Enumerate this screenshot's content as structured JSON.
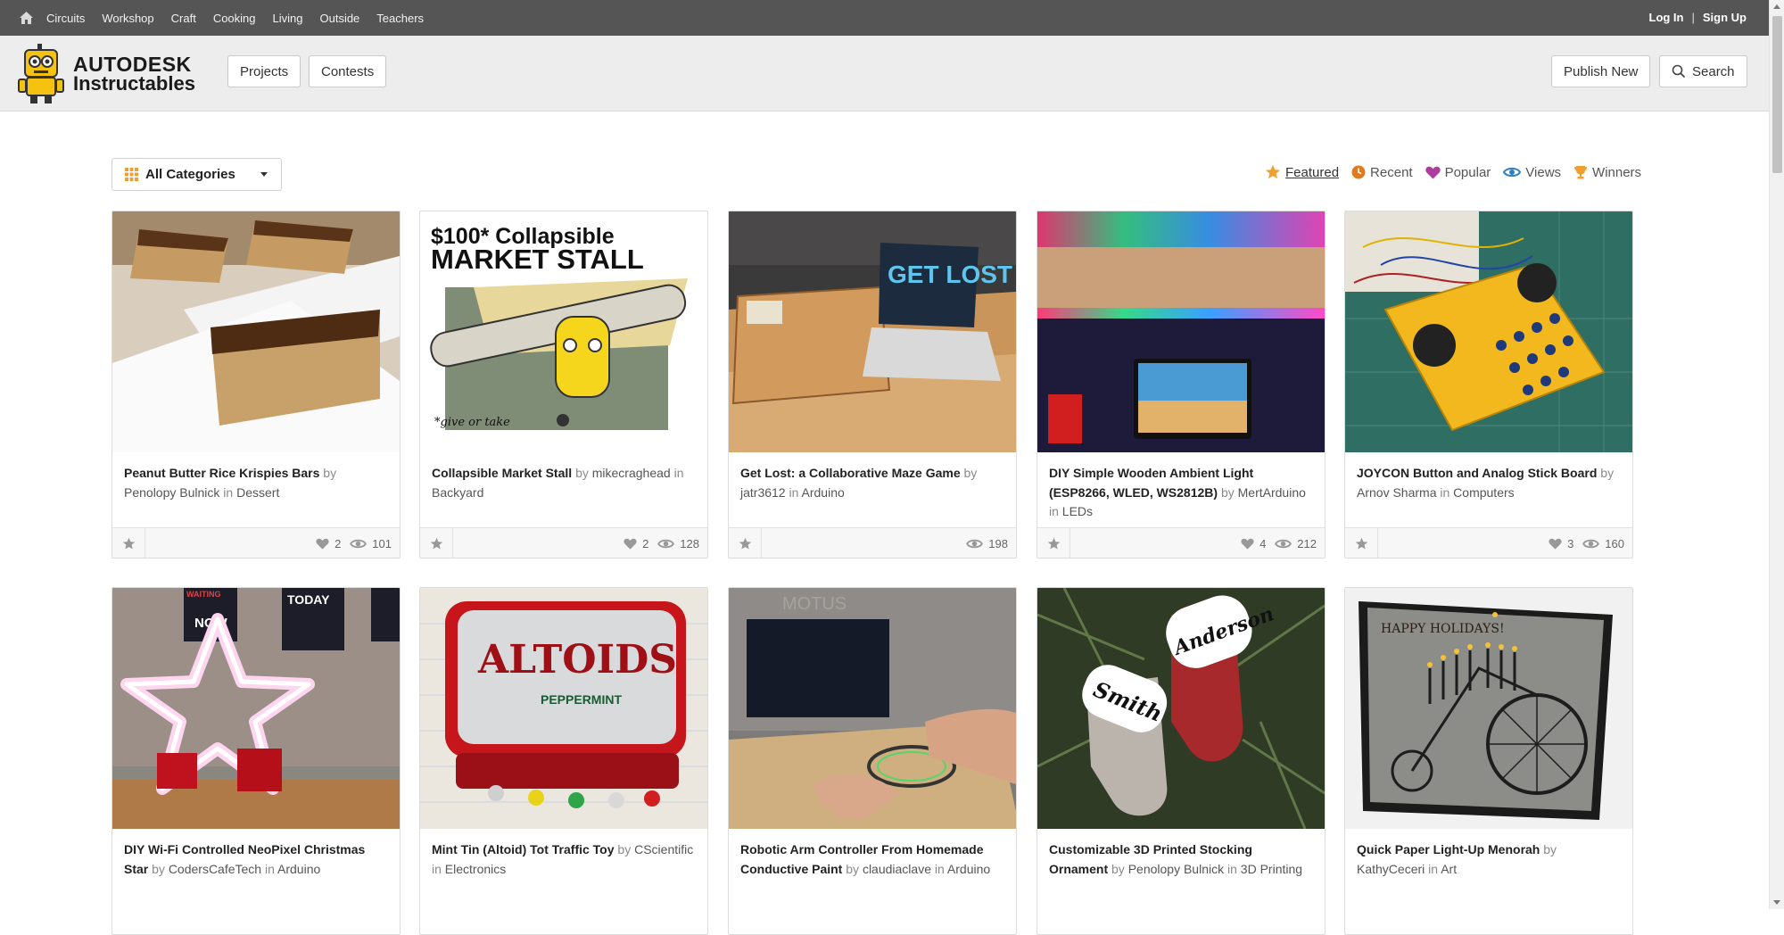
{
  "topnav": {
    "links": [
      "Circuits",
      "Workshop",
      "Craft",
      "Cooking",
      "Living",
      "Outside",
      "Teachers"
    ],
    "login": "Log In",
    "separator": "|",
    "signup": "Sign Up"
  },
  "header": {
    "logo_line1": "AUTODESK",
    "logo_line2": "Instructables",
    "projects_label": "Projects",
    "contests_label": "Contests",
    "publish_label": "Publish New",
    "search_label": "Search"
  },
  "filters": {
    "category": "All Categories",
    "sorts": [
      {
        "label": "Featured",
        "icon": "star-icon",
        "color": "#f0a030"
      },
      {
        "label": "Recent",
        "icon": "clock-icon",
        "color": "#e07a1f"
      },
      {
        "label": "Popular",
        "icon": "heart-icon",
        "color": "#b03aa0"
      },
      {
        "label": "Views",
        "icon": "eye-icon",
        "color": "#2e7fc2"
      },
      {
        "label": "Winners",
        "icon": "trophy-icon",
        "color": "#f0a030"
      }
    ]
  },
  "cards": [
    {
      "title": "Peanut Butter Rice Krispies Bars",
      "by": "by",
      "author": "Penolopy Bulnick",
      "in": "in",
      "category": "Dessert",
      "likes": "2",
      "views": "101"
    },
    {
      "title": "Collapsible Market Stall",
      "by": "by",
      "author": "mikecraghead",
      "in": "in",
      "category": "Backyard",
      "likes": "2",
      "views": "128"
    },
    {
      "title": "Get Lost: a Collaborative Maze Game",
      "by": "by",
      "author": "jatr3612",
      "in": "in",
      "category": "Arduino",
      "likes": "",
      "views": "198"
    },
    {
      "title": "DIY Simple Wooden Ambient Light (ESP8266, WLED, WS2812B)",
      "by": "by",
      "author": "MertArduino",
      "in": "in",
      "category": "LEDs",
      "likes": "4",
      "views": "212"
    },
    {
      "title": "JOYCON Button and Analog Stick Board",
      "by": "by",
      "author": "Arnov Sharma",
      "in": "in",
      "category": "Computers",
      "likes": "3",
      "views": "160"
    },
    {
      "title": "DIY Wi-Fi Controlled NeoPixel Christmas Star",
      "by": "by",
      "author": "CodersCafeTech",
      "in": "in",
      "category": "Arduino"
    },
    {
      "title": "Mint Tin (Altoid) Tot Traffic Toy",
      "by": "by",
      "author": "CScientific",
      "in": "in",
      "category": "Electronics"
    },
    {
      "title": "Robotic Arm Controller From Homemade Conductive Paint",
      "by": "by",
      "author": "claudiaclave",
      "in": "in",
      "category": "Arduino"
    },
    {
      "title": "Customizable 3D Printed Stocking Ornament",
      "by": "by",
      "author": "Penolopy Bulnick",
      "in": "in",
      "category": "3D Printing"
    },
    {
      "title": "Quick Paper Light-Up Menorah",
      "by": "by",
      "author": "KathyCeceri",
      "in": "in",
      "category": "Art"
    }
  ],
  "image_text": {
    "market_stall_line1": "$100* Collapsible",
    "market_stall_line2": "MARKET STALL",
    "market_stall_note": "*give or take",
    "get_lost": "GET LOST",
    "altoids": "ALTOIDS",
    "altoids_sub": "PEPPERMINT",
    "stocking_name1": "Anderson",
    "stocking_name2": "Smith",
    "menorah_card": "HAPPY HOLIDAYS!",
    "motus": "MOTUS",
    "poster_words": [
      "WAITING",
      "TODAY",
      "NOW"
    ]
  }
}
